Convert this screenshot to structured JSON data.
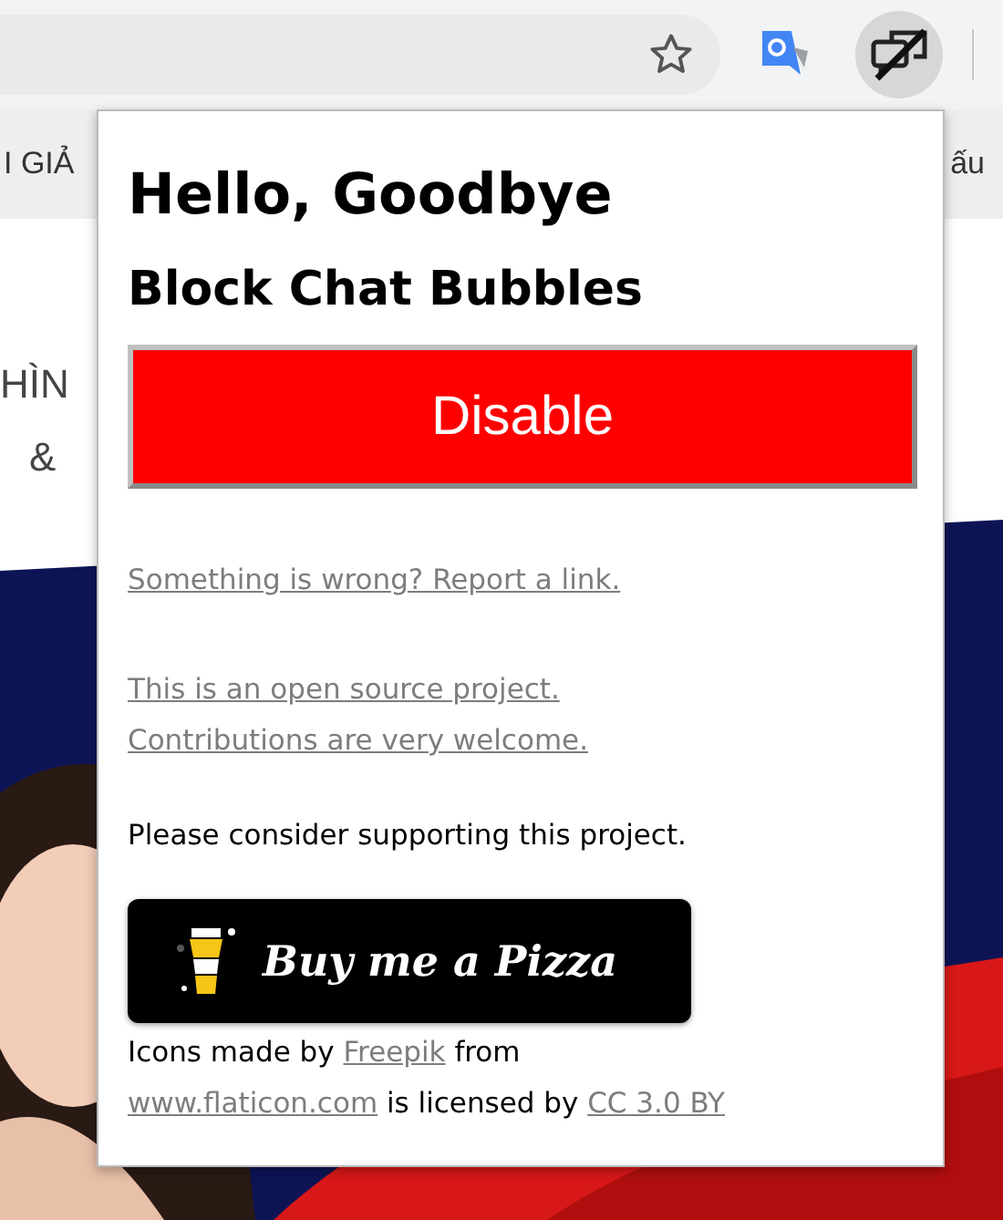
{
  "browser": {
    "bookmarks": [
      {
        "label": "I GIẢ"
      },
      {
        "label": "ấu"
      }
    ]
  },
  "page": {
    "texts": [
      "HÌN",
      "&"
    ]
  },
  "popup": {
    "title": "Hello, Goodbye",
    "subtitle": "Block Chat Bubbles",
    "toggle": {
      "label": "Disable",
      "kind": "disable"
    },
    "report_link": "Something is wrong? Report a link.",
    "source_links": [
      "This is an open source project.",
      "Contributions are very welcome."
    ],
    "support_text": "Please consider supporting this project.",
    "donate_button": "Buy me a Pizza",
    "credits": [
      [
        {
          "kind": "text",
          "text": "Icons made by "
        },
        {
          "kind": "link",
          "text": "Freepik"
        },
        {
          "kind": "text",
          "text": " from"
        }
      ],
      [
        {
          "kind": "link",
          "text": "www.flaticon.com"
        },
        {
          "kind": "text",
          "text": " is licensed by "
        },
        {
          "kind": "link",
          "text": "CC 3.0 BY"
        }
      ]
    ]
  }
}
